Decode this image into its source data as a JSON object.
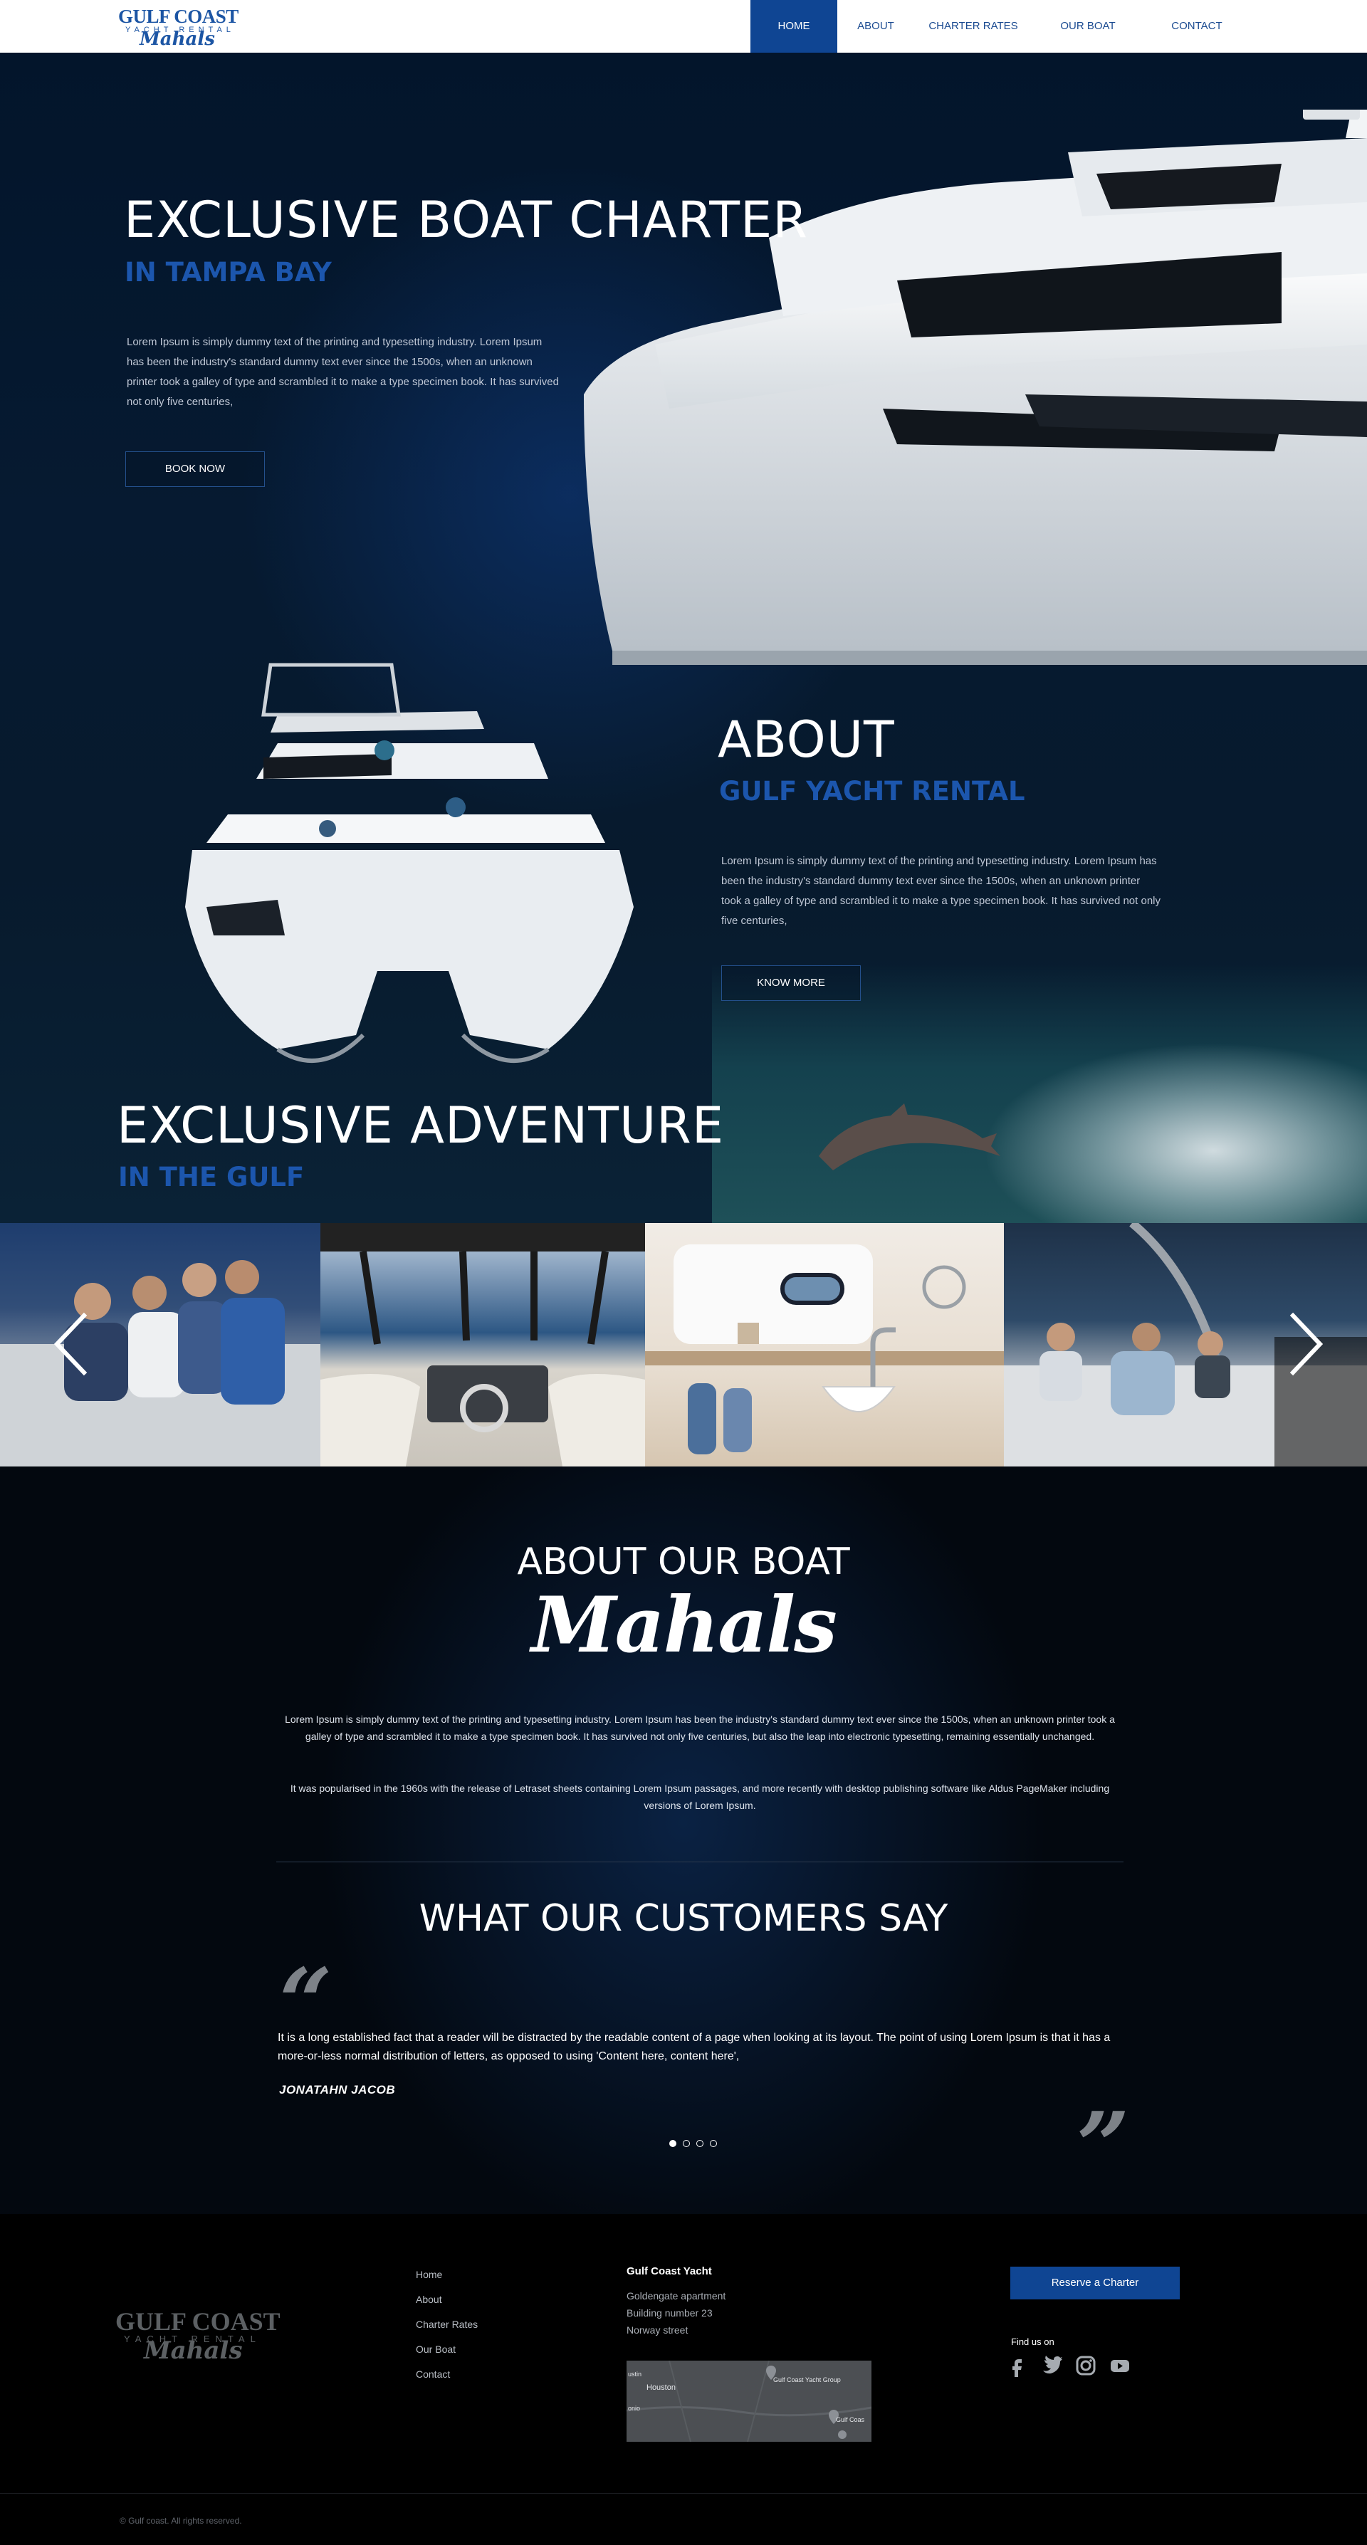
{
  "header": {
    "logo": {
      "line1": "GULF COAST",
      "line2": "YACHT RENTAL",
      "line3": "Mahals"
    },
    "nav": [
      {
        "label": "HOME",
        "active": true
      },
      {
        "label": "ABOUT",
        "active": false
      },
      {
        "label": "CHARTER RATES",
        "active": false
      },
      {
        "label": "OUR BOAT",
        "active": false
      },
      {
        "label": "CONTACT",
        "active": false
      }
    ]
  },
  "hero": {
    "title": "EXCLUSIVE BOAT CHARTER",
    "subtitle": "IN TAMPA BAY",
    "body": "Lorem Ipsum is simply dummy text of the printing and typesetting industry. Lorem Ipsum has been the industry's standard dummy text ever since the 1500s, when an unknown printer took a galley of type and scrambled it to make a type specimen book. It has survived not only five centuries,",
    "button": "BOOK NOW"
  },
  "about": {
    "title": "ABOUT",
    "subtitle": "GULF YACHT RENTAL",
    "body": "Lorem Ipsum is simply dummy text of the printing and typesetting industry. Lorem Ipsum has been the industry's standard dummy text ever since the 1500s, when an unknown printer took a galley of type and scrambled it to make a type specimen book. It has survived not only five centuries,",
    "button": "KNOW MORE"
  },
  "adventure": {
    "title": "EXCLUSIVE ADVENTURE",
    "subtitle": "IN THE GULF"
  },
  "gallery": {
    "prev_icon": "chevron-left-icon",
    "next_icon": "chevron-right-icon"
  },
  "about_boat": {
    "title": "ABOUT OUR BOAT",
    "script": "Mahals",
    "para1": "Lorem Ipsum is simply dummy text of the printing and typesetting industry. Lorem Ipsum has been the industry's standard dummy text ever since the 1500s, when an unknown printer took a galley of type and scrambled it to make a type specimen book. It has survived not only five centuries, but also the leap into electronic typesetting, remaining essentially unchanged.",
    "para2": "It was popularised in the 1960s with the release of Letraset sheets containing Lorem Ipsum passages, and more recently with desktop publishing software like Aldus PageMaker including versions of Lorem Ipsum."
  },
  "testimonials": {
    "title": "WHAT OUR CUSTOMERS SAY",
    "quote": "It is a long established fact that a reader will be distracted by the readable content of a page when looking at its layout. The point of using Lorem Ipsum is that it has a more-or-less normal distribution of letters, as opposed to using 'Content here, content here',",
    "author": "JONATAHN JACOB",
    "open_quote": "“",
    "close_quote": "”",
    "slide_count": 4,
    "active_slide": 1
  },
  "footer": {
    "logo": {
      "line1": "GULF COAST",
      "line2": "YACHT RENTAL",
      "line3": "Mahals"
    },
    "links": [
      "Home",
      "About",
      "Charter Rates",
      "Our Boat",
      "Contact"
    ],
    "company": "Gulf Coast Yacht",
    "address": [
      "Goldengate apartment",
      "Building number 23",
      "Norway street"
    ],
    "map_labels": [
      "Houston",
      "Gulf Coast Yacht Group",
      "Gulf Coas",
      "onio",
      "ustin"
    ],
    "reserve_button": "Reserve a Charter",
    "find_us": "Find us on",
    "social_icons": [
      "facebook-icon",
      "twitter-icon",
      "instagram-icon",
      "youtube-icon"
    ],
    "copyright": "© Gulf coast. All rights reserved."
  },
  "colors": {
    "accent": "#0f4593",
    "subtitle_blue": "#1c56ad",
    "bg_dark": "#03080f"
  }
}
